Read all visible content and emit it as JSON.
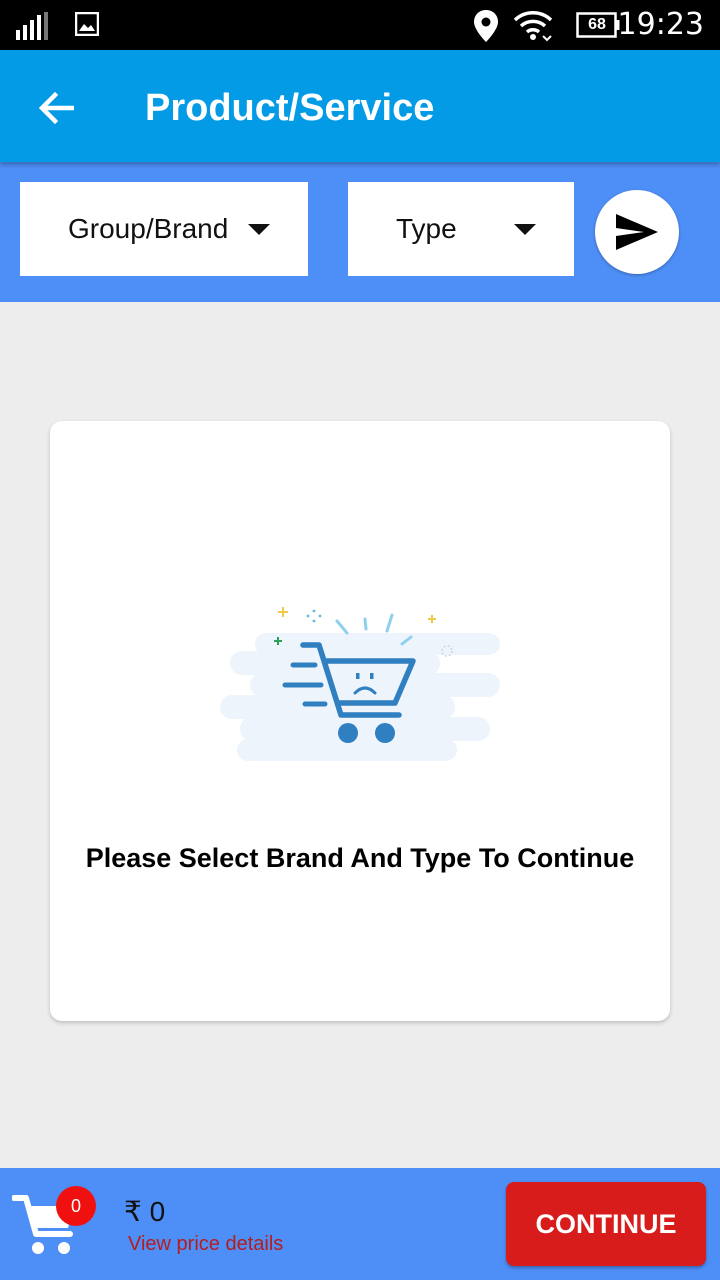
{
  "status_bar": {
    "time": "19:23",
    "battery": "68",
    "icons": [
      "signal-icon",
      "image-notification-icon",
      "location-icon",
      "wifi-icon",
      "battery-icon"
    ]
  },
  "app_bar": {
    "title": "Product/Service",
    "back_icon": "arrow-back-icon",
    "color": "#039be5"
  },
  "filters": {
    "group_brand_label": "Group/Brand",
    "type_label": "Type",
    "send_icon": "send-icon",
    "bar_color": "#4e8ff7"
  },
  "empty_state": {
    "message": "Please Select Brand And Type To Continue",
    "illustration": "sad-cart-icon"
  },
  "bottom_bar": {
    "cart_icon": "cart-icon",
    "cart_count": "0",
    "price": "₹ 0",
    "view_price_details": "View price details",
    "continue_label": "CONTINUE",
    "continue_color": "#d81b1b"
  }
}
